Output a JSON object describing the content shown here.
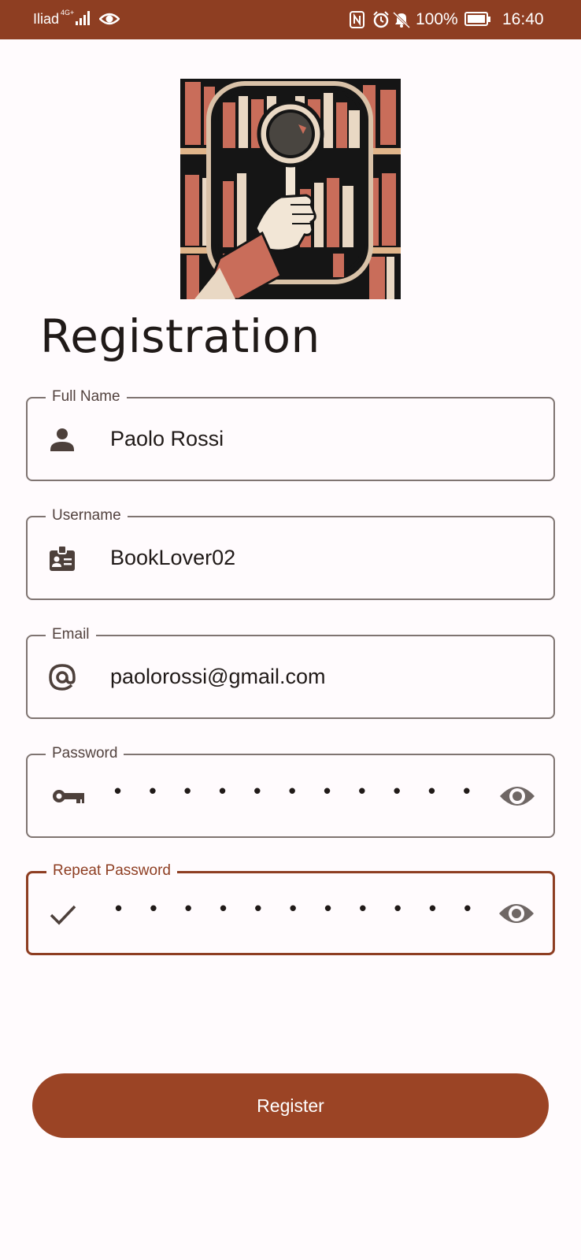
{
  "status_bar": {
    "carrier": "Iliad",
    "network": "4G+",
    "battery": "100%",
    "time": "16:40"
  },
  "form": {
    "title": "Registration",
    "fields": [
      {
        "label": "Full Name",
        "value": "Paolo Rossi",
        "icon": "person-icon"
      },
      {
        "label": "Username",
        "value": "BookLover02",
        "icon": "badge-icon"
      },
      {
        "label": "Email",
        "value": "paolorossi@gmail.com",
        "icon": "at-icon"
      },
      {
        "label": "Password",
        "value": "• • • • • • • • • • •",
        "icon": "key-icon"
      },
      {
        "label": "Repeat Password",
        "value": "• • • • • • • • • • •",
        "icon": "check-icon"
      }
    ],
    "register_label": "Register"
  },
  "colors": {
    "primary": "#8e3e22",
    "button": "#9b4425",
    "background": "#fffbfd",
    "outline": "#7f7471"
  }
}
